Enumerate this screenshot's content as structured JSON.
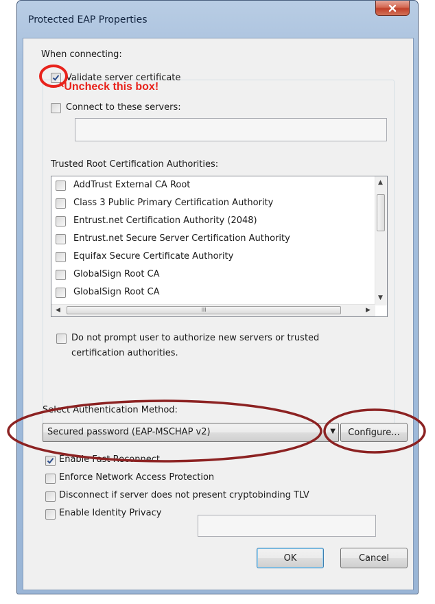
{
  "window": {
    "title": "Protected EAP Properties"
  },
  "connecting": {
    "heading": "When connecting:",
    "validate_cert_label": "Validate server certificate",
    "validate_cert_checked": true,
    "connect_servers_label": "Connect to these servers:",
    "connect_servers_checked": false,
    "servers_value": ""
  },
  "trusted_ca": {
    "label": "Trusted Root Certification Authorities:",
    "items": [
      {
        "label": "AddTrust External CA Root",
        "checked": false
      },
      {
        "label": "Class 3 Public Primary Certification Authority",
        "checked": false
      },
      {
        "label": "Entrust.net Certification Authority (2048)",
        "checked": false
      },
      {
        "label": "Entrust.net Secure Server Certification Authority",
        "checked": false
      },
      {
        "label": "Equifax Secure Certificate Authority",
        "checked": false
      },
      {
        "label": "GlobalSign Root CA",
        "checked": false
      },
      {
        "label": "GlobalSign Root CA",
        "checked": false
      }
    ],
    "hscroll_grip": "III"
  },
  "do_not_prompt": {
    "line1": "Do not prompt user to authorize new servers or trusted",
    "line2": "certification authorities.",
    "checked": false
  },
  "auth_method": {
    "label": "Select Authentication Method:",
    "selected": "Secured password (EAP-MSCHAP v2)",
    "configure_label": "Configure..."
  },
  "options": [
    {
      "label": "Enable Fast Reconnect",
      "checked": true
    },
    {
      "label": "Enforce Network Access Protection",
      "checked": false
    },
    {
      "label": "Disconnect if server does not present cryptobinding TLV",
      "checked": false
    },
    {
      "label": "Enable Identity Privacy",
      "checked": false
    }
  ],
  "identity_privacy_value": "",
  "buttons": {
    "ok": "OK",
    "cancel": "Cancel"
  },
  "annotation": {
    "text": "^Uncheck this box!",
    "color": "#e8231c"
  }
}
